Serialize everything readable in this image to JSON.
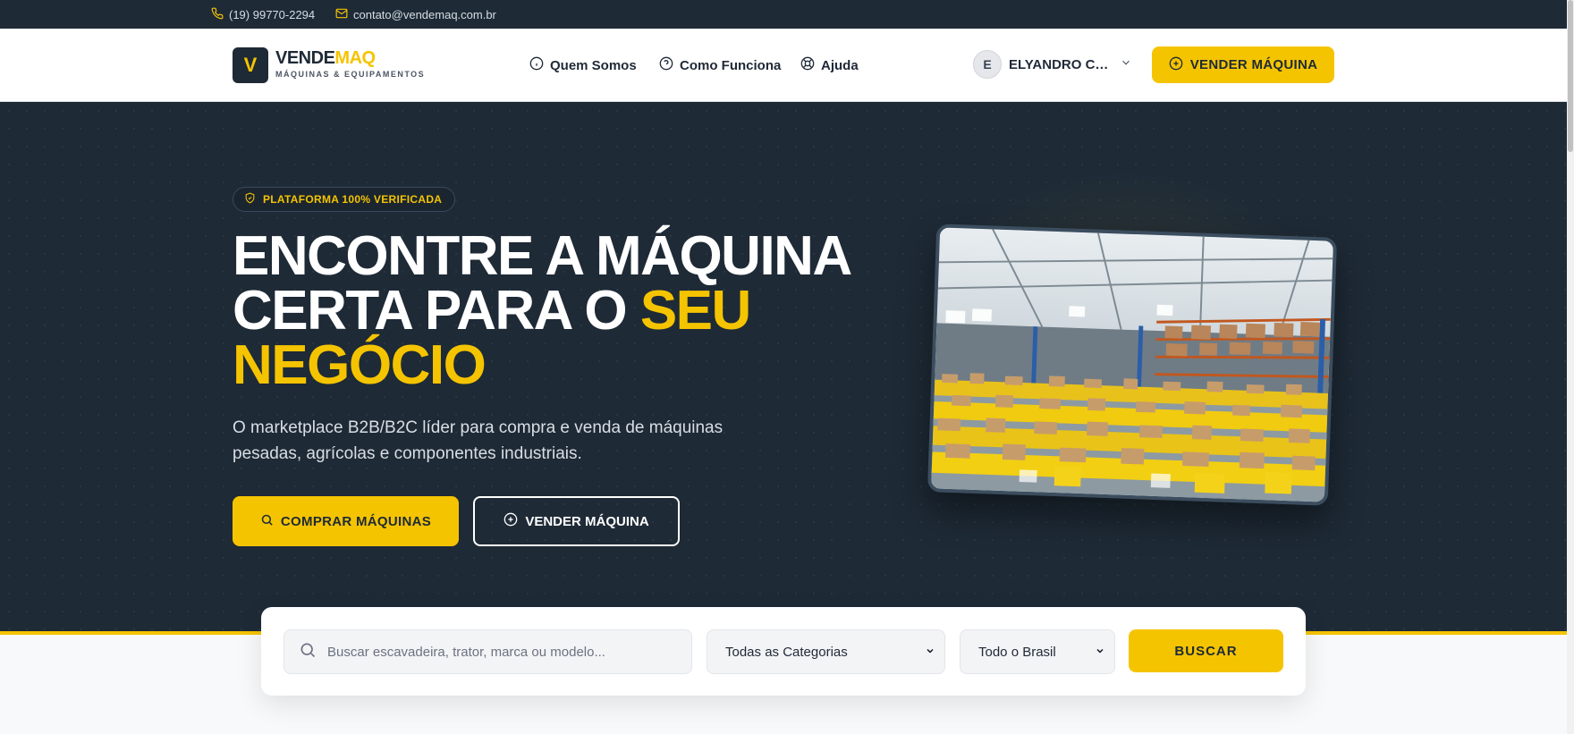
{
  "topbar": {
    "phone": "(19) 99770-2294",
    "email": "contato@vendemaq.com.br"
  },
  "brand": {
    "logo_letter": "V",
    "name_part1": "VENDE",
    "name_part2": "MAQ",
    "tagline": "MÁQUINAS & EQUIPAMENTOS"
  },
  "nav": {
    "links": [
      "Quem Somos",
      "Como Funciona",
      "Ajuda"
    ],
    "user_initial": "E",
    "user_name": "ELYANDRO CO...",
    "sell_button": "VENDER MÁQUINA"
  },
  "hero": {
    "badge": "PLATAFORMA 100% VERIFICADA",
    "headline_line1": "ENCONTRE A MÁQUINA",
    "headline_line2_white": "CERTA PARA O ",
    "headline_line2_yellow": "SEU",
    "headline_line3_yellow": "NEGÓCIO",
    "subtitle": "O marketplace B2B/B2C líder para compra e venda de máquinas pesadas, agrícolas e componentes industriais.",
    "buy_button": "COMPRAR MÁQUINAS",
    "sell_button": "VENDER MÁQUINA"
  },
  "search": {
    "placeholder": "Buscar escavadeira, trator, marca ou modelo...",
    "category_selected": "Todas as Categorias",
    "region_selected": "Todo o Brasil",
    "submit": "BUSCAR"
  },
  "colors": {
    "accent": "#f5c400",
    "dark": "#1e2a36"
  }
}
